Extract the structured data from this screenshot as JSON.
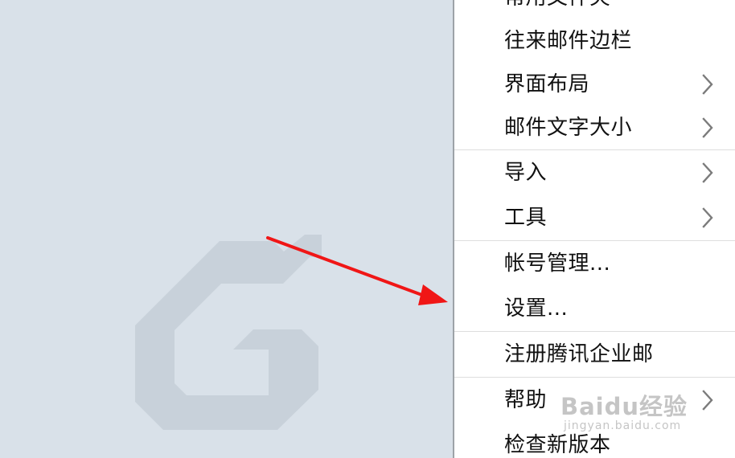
{
  "app": {
    "background_color": "#d9e1e9",
    "background_logo_icon": "stylized-g-logo-icon"
  },
  "menu": {
    "groups": [
      {
        "items": [
          {
            "label": "常用文件夹",
            "has_submenu": false
          },
          {
            "label": "往来邮件边栏",
            "has_submenu": false
          },
          {
            "label": "界面布局",
            "has_submenu": true
          },
          {
            "label": "邮件文字大小",
            "has_submenu": true
          }
        ]
      },
      {
        "items": [
          {
            "label": "导入",
            "has_submenu": true
          },
          {
            "label": "工具",
            "has_submenu": true
          }
        ]
      },
      {
        "items": [
          {
            "label": "帐号管理...",
            "has_submenu": false
          },
          {
            "label": "设置...",
            "has_submenu": false
          }
        ]
      },
      {
        "items": [
          {
            "label": "注册腾讯企业邮",
            "has_submenu": false
          }
        ]
      },
      {
        "items": [
          {
            "label": "帮助",
            "has_submenu": true
          },
          {
            "label": "检查新版本",
            "has_submenu": false
          }
        ]
      }
    ]
  },
  "annotation": {
    "arrow_color": "#f01616",
    "target": "设置..."
  },
  "watermark": {
    "brand": "Baidu经验",
    "url": "jingyan.baidu.com"
  }
}
